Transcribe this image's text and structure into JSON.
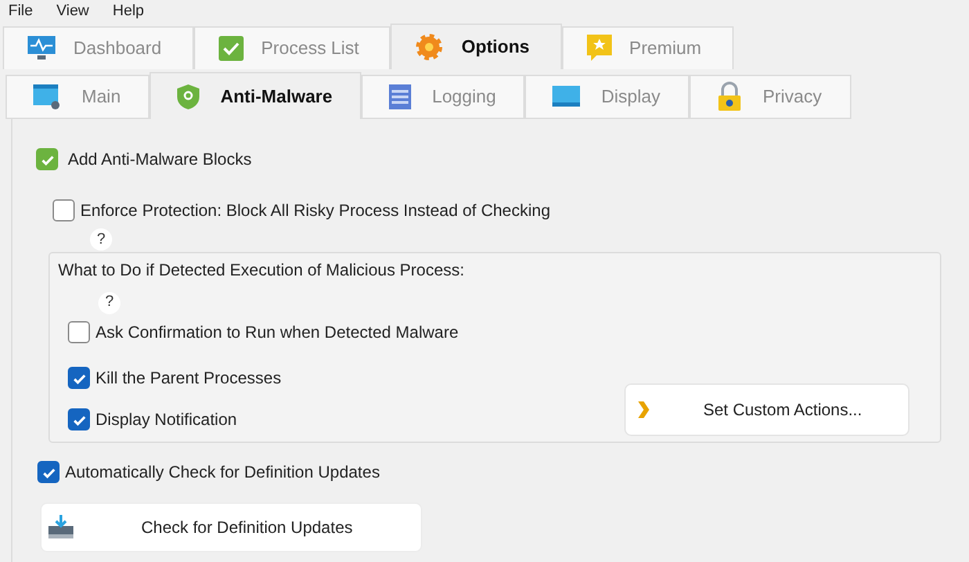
{
  "menu": [
    "File",
    "View",
    "Help"
  ],
  "tabs": [
    {
      "label": "Dashboard",
      "selected": false
    },
    {
      "label": "Process List",
      "selected": false
    },
    {
      "label": "Options",
      "selected": true
    },
    {
      "label": "Premium",
      "selected": false
    }
  ],
  "subtabs": [
    {
      "label": "Main",
      "selected": false
    },
    {
      "label": "Anti-Malware",
      "selected": true
    },
    {
      "label": "Logging",
      "selected": false
    },
    {
      "label": "Display",
      "selected": false
    },
    {
      "label": "Privacy",
      "selected": false
    }
  ],
  "add_blocks": {
    "label": "Add Anti-Malware Blocks",
    "checked": true
  },
  "enforce": {
    "label": "Enforce Protection: Block All Risky Process Instead of Checking",
    "checked": false,
    "help": "?"
  },
  "group": {
    "title": "What to Do if Detected Execution of Malicious Process:",
    "help": "?",
    "options": [
      {
        "label": "Ask Confirmation to Run when Detected Malware",
        "checked": false
      },
      {
        "label": "Kill the Parent Processes",
        "checked": true
      },
      {
        "label": "Display Notification",
        "checked": true
      }
    ],
    "button": "Set Custom Actions..."
  },
  "auto_check": {
    "label": "Automatically Check for Definition Updates",
    "checked": true
  },
  "check_button": "Check for Definition Updates"
}
